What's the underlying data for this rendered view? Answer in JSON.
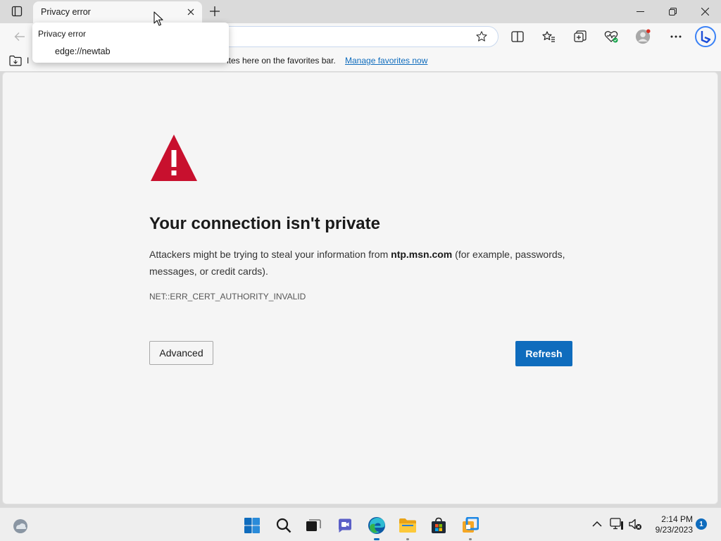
{
  "browser": {
    "tab": {
      "title": "Privacy error"
    },
    "tooltip": {
      "title": "Privacy error",
      "url": "edge://newtab"
    },
    "favorites_bar": {
      "text_left": "I",
      "text_right": "ites here on the favorites bar.",
      "manage_link": "Manage favorites now"
    },
    "toolbar_icons": [
      "split-screen-icon",
      "favorites-icon",
      "collections-icon",
      "browser-essentials-icon",
      "profile-avatar",
      "more-menu-icon",
      "bing-copilot-icon"
    ]
  },
  "page": {
    "headline": "Your connection isn't private",
    "description_before": "Attackers might be trying to steal your information from ",
    "domain": "ntp.msn.com",
    "description_after": " (for example, passwords, messages, or credit cards).",
    "error_code": "NET::ERR_CERT_AUTHORITY_INVALID",
    "advanced_label": "Advanced",
    "refresh_label": "Refresh",
    "colors": {
      "warning_red": "#c8102e",
      "accent_blue": "#0f6cbd"
    }
  },
  "taskbar": {
    "apps": [
      "start-icon",
      "search-icon",
      "task-view-icon",
      "chat-icon",
      "edge-icon",
      "file-explorer-icon",
      "store-icon",
      "vmware-icon"
    ],
    "time": "2:14 PM",
    "date": "9/23/2023",
    "notification_count": "1"
  }
}
